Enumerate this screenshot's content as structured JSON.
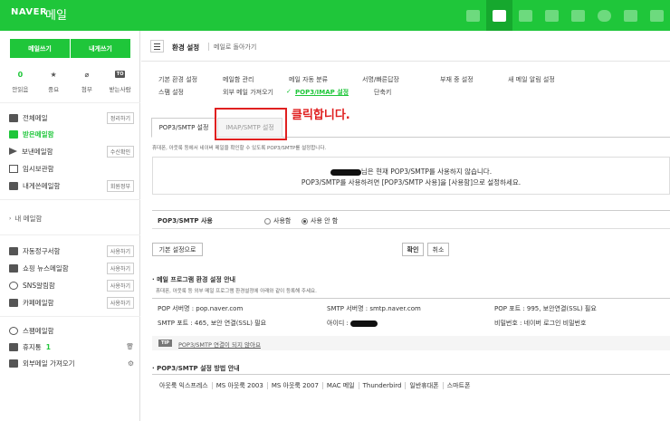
{
  "header": {
    "logo": "NAVER",
    "service": "메일",
    "icons": [
      "mail-icon",
      "package-icon",
      "calendar-icon",
      "contacts-icon",
      "phone-icon",
      "cloud-icon",
      "image-icon",
      "home-icon"
    ]
  },
  "sidebar": {
    "write_label": "메일쓰기",
    "self_write_label": "내게쓰기",
    "quick": [
      {
        "top": "0",
        "label": "안읽음"
      },
      {
        "top": "★",
        "label": "중요"
      },
      {
        "top": "📎",
        "label": "첨부"
      },
      {
        "top": "TO",
        "label": "받는사람"
      }
    ],
    "mailboxes": [
      {
        "label": "전체메일",
        "right": "정리하기"
      },
      {
        "label": "받은메일함",
        "right": ""
      },
      {
        "label": "보낸메일함",
        "right": "수신확인"
      },
      {
        "label": "임시보관함",
        "right": ""
      },
      {
        "label": "내게쓴메일함",
        "right": "회원정부"
      }
    ],
    "my_mailbox": "내 메일함",
    "extra": [
      {
        "label": "자동정구서함",
        "right": "사용하기"
      },
      {
        "label": "쇼핑 뉴스메일함",
        "right": "사용하기"
      },
      {
        "label": "SNS알림함",
        "right": "사용하기"
      },
      {
        "label": "카페메일함",
        "right": "사용하기"
      }
    ],
    "spam": "스팸메일함",
    "trash": "휴지통",
    "trash_count": "1",
    "external": "외부메일 가져오기"
  },
  "toolbar": {
    "title": "환경 설정",
    "back": "메일로 돌아가기"
  },
  "settings_links": {
    "row1": [
      "기본 환경 설정",
      "메일함 관리",
      "메일 자동 분류",
      "서명/빠른답장",
      "부재 중 설정",
      "새 메일 알림 설정"
    ],
    "row2": [
      "스팸 설정",
      "외부 메일 가져오기",
      "POP3/IMAP 설정",
      "단축키"
    ]
  },
  "tabs": {
    "pop3": "POP3/SMTP 설정",
    "imap": "IMAP/SMTP 설정"
  },
  "annotation": "클릭합니다.",
  "description": "휴대폰, 아웃룩 등에서 네이버 메일을 확인할 수 있도록 POP3/SMTP를 설정합니다.",
  "info": {
    "line1_suffix": "님은 현재 POP3/SMTP를 사용하지 않습니다.",
    "line2": "POP3/SMTP를 사용하려면 [POP3/SMTP 사용]을 [사용함]으로 설정하세요."
  },
  "use_setting": {
    "label": "POP3/SMTP 사용",
    "options": [
      "사용함",
      "사용 안 함"
    ],
    "selected": "사용 안 함"
  },
  "buttons": {
    "default": "기본 설정으로",
    "confirm": "확인",
    "cancel": "취소"
  },
  "program_section": {
    "title": "· 메일 프로그램 환경 설정 안내",
    "subtitle": "휴대폰, 아웃룩 등 외부 메일 프로그램 환경설정에 아래와 같이 등록해 주세요.",
    "pop_server": "POP 서버명 : pop.naver.com",
    "smtp_server": "SMTP 서버명 : smtp.naver.com",
    "pop_port": "POP 포트 : 995, 보안연결(SSL) 필요",
    "smtp_port": "SMTP 포트 : 465, 보안 연결(SSL) 필요",
    "id_label": "아이디 :",
    "password": "비밀번호 : 네이버 로그인 비밀번호"
  },
  "tip": {
    "badge": "TIP",
    "text": "POP3/SMTP 연결이 되지 않아요"
  },
  "method_section": {
    "title": "· POP3/SMTP 설정 방법 안내",
    "clients": [
      "아웃룩 익스프레스",
      "MS 아웃룩 2003",
      "MS 아웃룩 2007",
      "MAC 메일",
      "Thunderbird",
      "일반휴대폰",
      "스마트폰"
    ]
  }
}
